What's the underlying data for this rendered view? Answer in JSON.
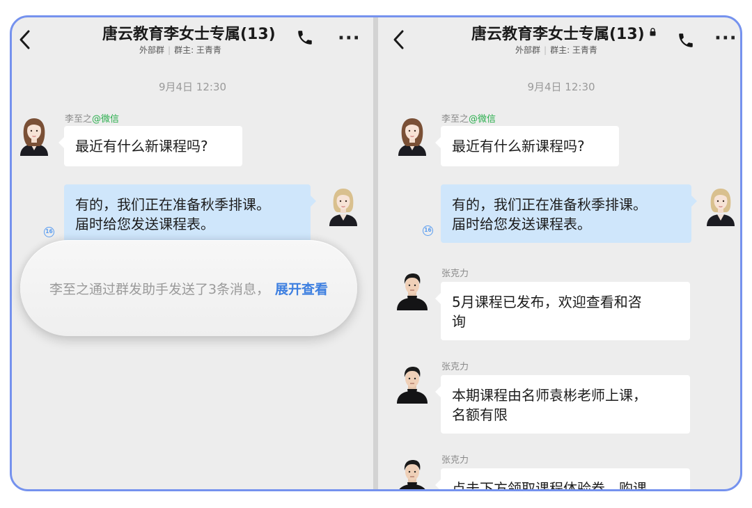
{
  "left": {
    "title": "唐云教育李女士专属(13)",
    "subtitle_group": "外部群",
    "subtitle_owner": "群主: 王青青",
    "time": "9月4日 12:30",
    "messages": [
      {
        "sender": "李至之",
        "tag": "@微信",
        "text": "最近有什么新课程吗?"
      },
      {
        "text_line1": "有的，我们正在准备秋季排课。",
        "text_line2": "届时给您发送课程表。",
        "read_count": "16"
      }
    ],
    "banner_text": "李至之通过群发助手发送了3条消息，",
    "banner_link": "展开查看"
  },
  "right": {
    "title": "唐云教育李女士专属(13)",
    "subtitle_group": "外部群",
    "subtitle_owner": "群主: 王青青",
    "time": "9月4日 12:30",
    "messages": [
      {
        "sender": "李至之",
        "tag": "@微信",
        "text": "最近有什么新课程吗?"
      },
      {
        "text_line1": "有的，我们正在准备秋季排课。",
        "text_line2": "届时给您发送课程表。",
        "read_count": "16"
      },
      {
        "sender": "张克力",
        "text_line1": "5月课程已发布，欢迎查看和咨",
        "text_line2": "询"
      },
      {
        "sender": "张克力",
        "text_line1": "本期课程由名师袁彬老师上课，",
        "text_line2": "名额有限"
      },
      {
        "sender": "张克力",
        "text_line1": "点击下方领取课程体验券，购课"
      }
    ]
  },
  "icons": {
    "back": "chevron-left-icon",
    "call": "phone-icon",
    "more": "more-icon",
    "lock": "lock-icon"
  },
  "colors": {
    "frame_border": "#7592ee",
    "chat_bg": "#ededed",
    "sent_bubble": "#cfe6fb",
    "received_bubble": "#ffffff",
    "link": "#3d7fe0",
    "wechat_tag": "#2aae4d"
  }
}
